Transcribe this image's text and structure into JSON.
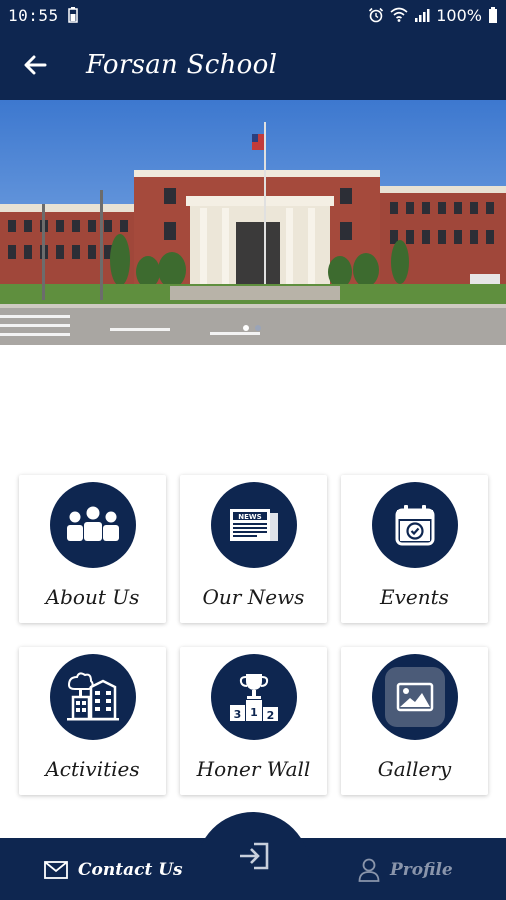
{
  "status": {
    "time": "10:55",
    "battery": "100%"
  },
  "header": {
    "title": "Forsan School",
    "back_icon": "arrow-left-icon"
  },
  "banner": {
    "carousel_dots": 2,
    "active_dot": 0
  },
  "menu": [
    {
      "label": "About Us",
      "icon": "group-icon"
    },
    {
      "label": "Our News",
      "icon": "newspaper-icon"
    },
    {
      "label": "Events",
      "icon": "calendar-check-icon"
    },
    {
      "label": "Activities",
      "icon": "buildings-icon"
    },
    {
      "label": "Honer Wall",
      "icon": "podium-trophy-icon"
    },
    {
      "label": "Gallery",
      "icon": "image-icon"
    }
  ],
  "bottom_nav": {
    "contact_label": "Contact Us",
    "profile_label": "Profile",
    "center_icon": "login-icon"
  },
  "colors": {
    "primary": "#0e2650",
    "muted": "#8a95ab"
  }
}
